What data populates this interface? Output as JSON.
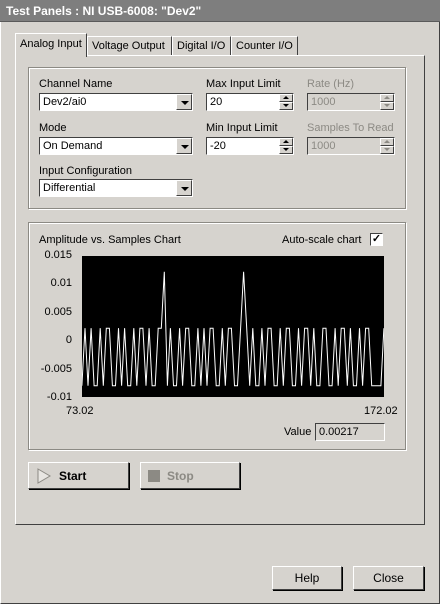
{
  "window": {
    "title": "Test Panels : NI USB-6008: \"Dev2\""
  },
  "tabs": [
    {
      "label": "Analog Input"
    },
    {
      "label": "Voltage Output"
    },
    {
      "label": "Digital I/O"
    },
    {
      "label": "Counter I/O"
    }
  ],
  "settings": {
    "channel_name": {
      "label": "Channel Name",
      "value": "Dev2/ai0"
    },
    "mode": {
      "label": "Mode",
      "value": "On Demand"
    },
    "input_config": {
      "label": "Input Configuration",
      "value": "Differential"
    },
    "max_input": {
      "label": "Max Input Limit",
      "value": "20"
    },
    "min_input": {
      "label": "Min Input Limit",
      "value": "-20"
    },
    "rate": {
      "label": "Rate (Hz)",
      "value": "1000"
    },
    "samples": {
      "label": "Samples To Read",
      "value": "1000"
    }
  },
  "chart": {
    "title": "Amplitude vs. Samples Chart",
    "autoscale_label": "Auto-scale chart",
    "autoscale_checked": true,
    "value_label": "Value",
    "value": "0.00217"
  },
  "chart_data": {
    "type": "line",
    "title": "Amplitude vs. Samples Chart",
    "xlabel": "",
    "ylabel": "",
    "xlim": [
      73.02,
      172.02
    ],
    "ylim": [
      -0.01,
      0.015
    ],
    "x_ticks": [
      "73.02",
      "172.02"
    ],
    "y_ticks": [
      "0.015",
      "0.01",
      "0.005",
      "0",
      "-0.005",
      "-0.01"
    ],
    "line_color": "#ffffff",
    "background": "#000000",
    "series": [
      {
        "x": [
          73,
          74,
          75,
          76,
          77,
          78,
          79,
          80,
          81,
          82,
          83,
          84,
          85,
          86,
          87,
          88,
          89,
          90,
          91,
          92,
          93,
          94,
          95,
          96,
          97,
          98,
          99,
          100,
          101,
          102,
          103,
          104,
          105,
          106,
          107,
          108,
          109,
          110,
          111,
          112,
          113,
          114,
          115,
          116,
          117,
          118,
          119,
          120,
          121,
          122,
          123,
          124,
          125,
          126,
          127,
          128,
          129,
          130,
          131,
          132,
          133,
          134,
          135,
          136,
          137,
          138,
          139,
          140,
          141,
          142,
          143,
          144,
          145,
          146,
          147,
          148,
          149,
          150,
          151,
          152,
          153,
          154,
          155,
          156,
          157,
          158,
          159,
          160,
          161,
          162,
          163,
          164,
          165,
          166,
          167,
          168,
          169,
          170,
          171,
          172
        ],
        "y": [
          -0.008,
          0.0022,
          -0.008,
          0.0022,
          -0.008,
          -0.008,
          0.0022,
          -0.008,
          0.0022,
          0.0022,
          -0.008,
          -0.008,
          0.0022,
          -0.008,
          0.0022,
          -0.008,
          -0.008,
          0.0022,
          -0.008,
          0.0022,
          0.0022,
          -0.008,
          0.0022,
          -0.008,
          -0.008,
          0.0022,
          0.0022,
          0.0122,
          -0.008,
          0.0022,
          -0.008,
          -0.008,
          0.0022,
          -0.008,
          0.0022,
          0.0022,
          -0.008,
          -0.008,
          0.0022,
          -0.008,
          0.0022,
          -0.008,
          0.0022,
          0.0022,
          -0.008,
          -0.008,
          0.0022,
          -0.008,
          0.0022,
          0.0022,
          -0.008,
          -0.008,
          0.0022,
          0.0122,
          0.0022,
          -0.008,
          0.0022,
          -0.008,
          -0.008,
          0.0022,
          -0.008,
          0.0022,
          0.0022,
          -0.008,
          -0.008,
          0.0022,
          -0.008,
          0.0022,
          0.0022,
          -0.008,
          -0.008,
          0.0022,
          -0.008,
          0.0022,
          0.0022,
          -0.008,
          0.0022,
          -0.008,
          -0.008,
          0.0022,
          0.0022,
          -0.008,
          -0.008,
          0.0022,
          -0.008,
          0.0022,
          0.0022,
          -0.008,
          0.0022,
          -0.008,
          -0.008,
          0.0022,
          -0.008,
          0.0022,
          0.0022,
          -0.008,
          -0.008,
          -0.008,
          -0.008,
          0.0022
        ]
      }
    ]
  },
  "buttons": {
    "start": "Start",
    "stop": "Stop",
    "help": "Help",
    "close": "Close"
  }
}
